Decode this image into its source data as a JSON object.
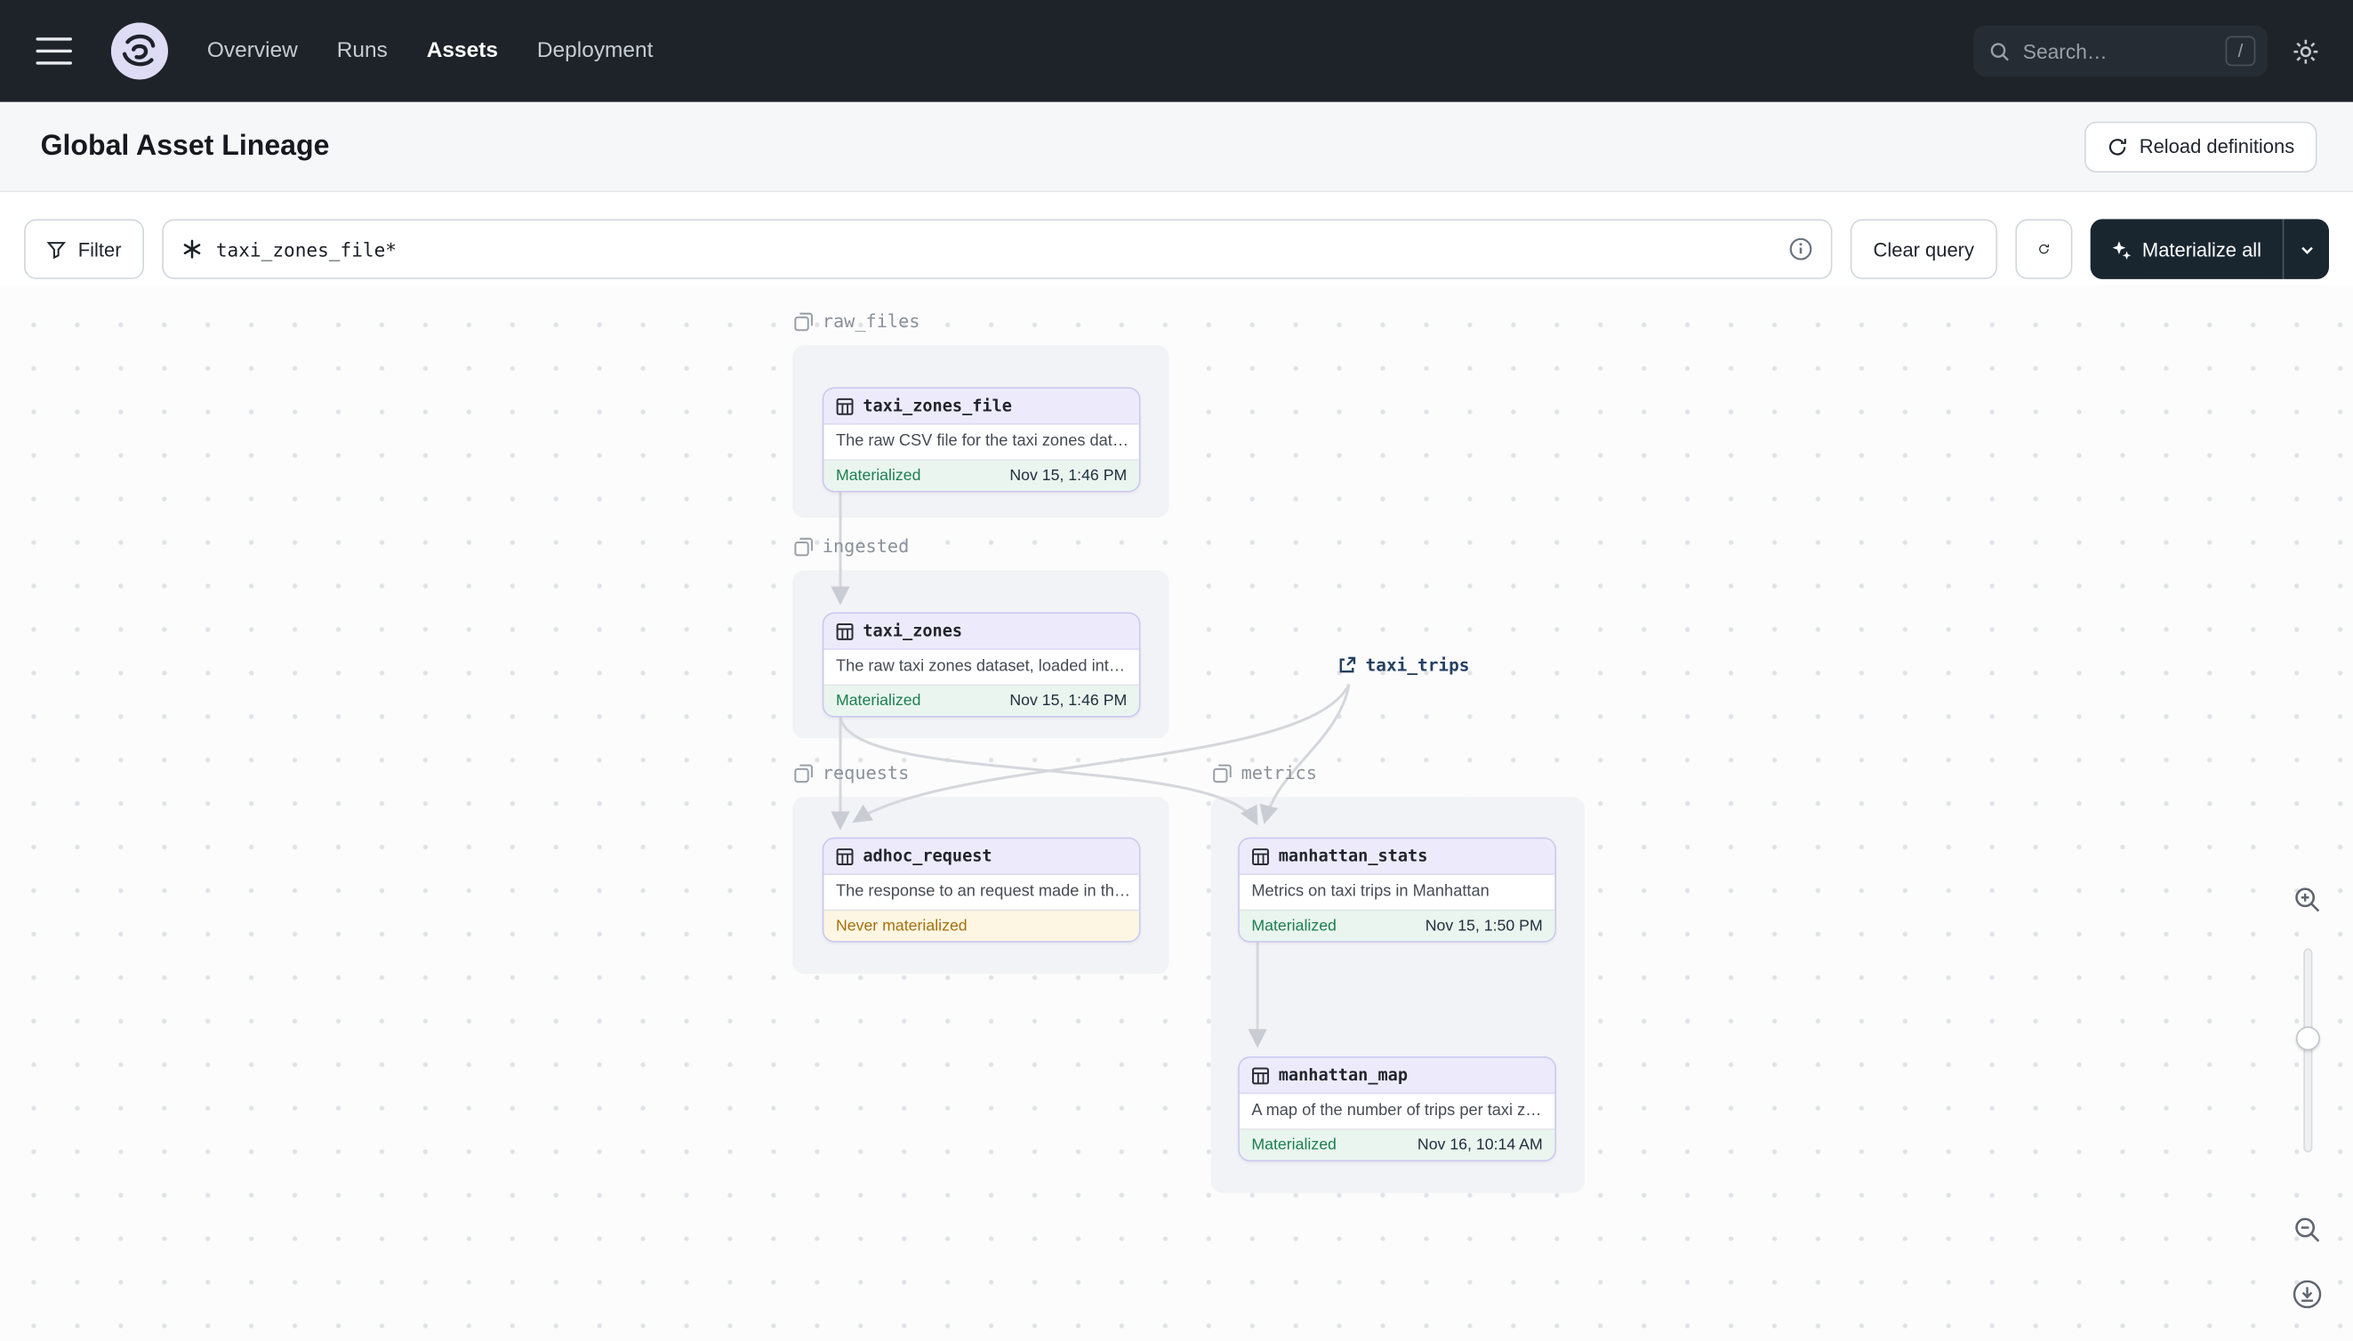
{
  "nav": {
    "items": [
      {
        "label": "Overview",
        "active": false
      },
      {
        "label": "Runs",
        "active": false
      },
      {
        "label": "Assets",
        "active": true
      },
      {
        "label": "Deployment",
        "active": false
      }
    ],
    "search_placeholder": "Search…",
    "search_shortcut": "/"
  },
  "header": {
    "title": "Global Asset Lineage",
    "reload_button": "Reload definitions"
  },
  "toolbar": {
    "filter_label": "Filter",
    "query_value": "taxi_zones_file*",
    "clear_label": "Clear query",
    "materialize_label": "Materialize all"
  },
  "graph": {
    "groups": [
      {
        "name": "raw_files"
      },
      {
        "name": "ingested"
      },
      {
        "name": "requests"
      },
      {
        "name": "metrics"
      }
    ],
    "nodes": [
      {
        "id": "taxi_zones_file",
        "group": "raw_files",
        "description": "The raw CSV file for the taxi zones dat…",
        "status": "Materialized",
        "timestamp": "Nov 15, 1:46 PM"
      },
      {
        "id": "taxi_zones",
        "group": "ingested",
        "description": "The raw taxi zones dataset, loaded int…",
        "status": "Materialized",
        "timestamp": "Nov 15, 1:46 PM"
      },
      {
        "id": "adhoc_request",
        "group": "requests",
        "description": "The response to an request made in th…",
        "status": "Never materialized",
        "timestamp": ""
      },
      {
        "id": "manhattan_stats",
        "group": "metrics",
        "description": "Metrics on taxi trips in Manhattan",
        "status": "Materialized",
        "timestamp": "Nov 15, 1:50 PM"
      },
      {
        "id": "manhattan_map",
        "group": "metrics",
        "description": "A map of the number of trips per taxi z…",
        "status": "Materialized",
        "timestamp": "Nov 16, 10:14 AM"
      }
    ],
    "external_nodes": [
      {
        "id": "taxi_trips"
      }
    ],
    "edges": [
      {
        "from": "taxi_zones_file",
        "to": "taxi_zones"
      },
      {
        "from": "taxi_zones",
        "to": "adhoc_request"
      },
      {
        "from": "taxi_zones",
        "to": "manhattan_stats"
      },
      {
        "from": "taxi_trips",
        "to": "adhoc_request"
      },
      {
        "from": "taxi_trips",
        "to": "manhattan_stats"
      },
      {
        "from": "manhattan_stats",
        "to": "manhattan_map"
      }
    ]
  },
  "colors": {
    "nav_bg": "#1E232A",
    "node_border_lavender": "#CBC8F1",
    "node_header_bg": "#EDEBFB",
    "materialized_green": "#1C7F4F",
    "never_materialized_amber": "#A8700F",
    "timestamp_navy": "#21303F",
    "edge_gray": "#D5D7DC",
    "materialize_button_bg": "#192630",
    "external_link_navy": "#243F61"
  }
}
